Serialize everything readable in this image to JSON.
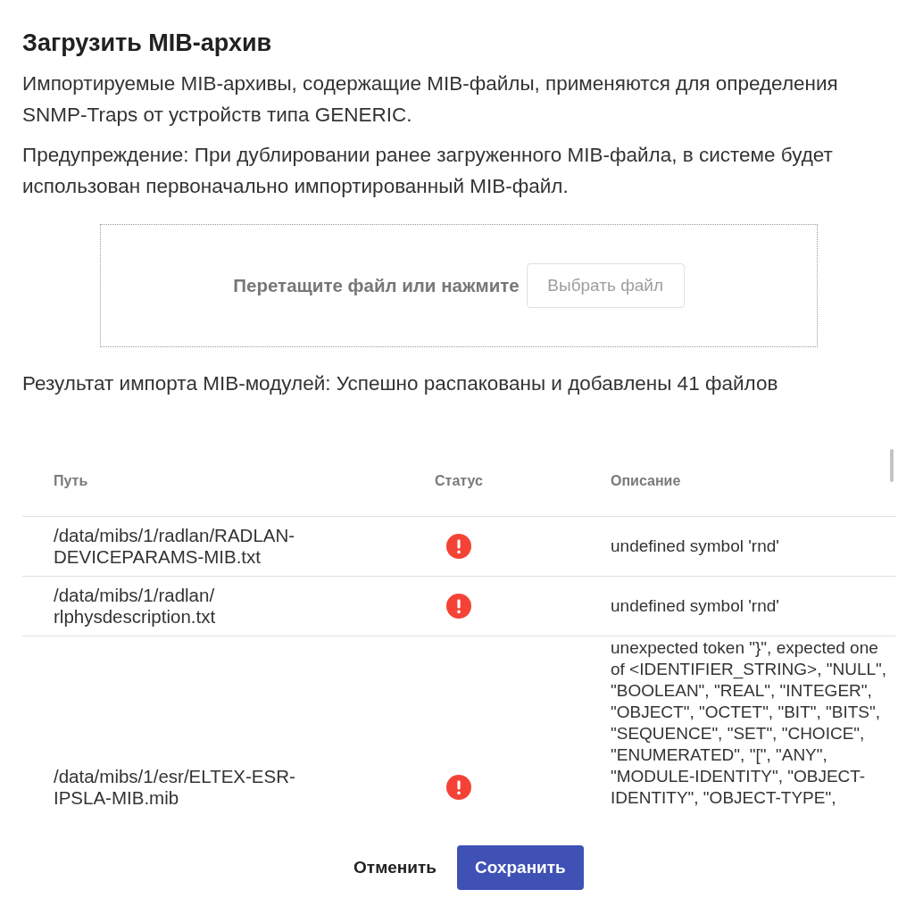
{
  "dialog": {
    "title": "Загрузить MIB-архив"
  },
  "paragraphs": [
    "Импортируемые MIB-архивы, содержащие MIB-файлы, применяются для определения SNMP-Traps от устройств типа GENERIC.",
    "Предупреждение: При дублировании ранее загруженного MIB-файла, в системе будет использован первоначально импортированный MIB-файл."
  ],
  "dropzone": {
    "prompt": "Перетащите файл или нажмите",
    "button": "Выбрать файл"
  },
  "result": "Результат импорта MIB-модулей: Успешно распакованы и добавлены 41 файлов",
  "table": {
    "columns": [
      "Путь",
      "Статус",
      "Описание"
    ],
    "rows": [
      {
        "path": "/data/mibs/1/radlan/RADLAN-DEVICEPARAMS-MIB.txt",
        "error": true,
        "description": "undefined symbol 'rnd'"
      },
      {
        "path": "/data/mibs/1/radlan/rlphysdescription.txt",
        "error": true,
        "description": "undefined symbol 'rnd'"
      },
      {
        "path": "/data/mibs/1/esr/ELTEX-ESR-IPSLA-MIB.mib",
        "error": true,
        "description": "unexpected token \"}\", expected one of <IDENTIFIER_STRING>, \"NULL\", \"BOOLEAN\", \"REAL\", \"INTEGER\", \"OBJECT\", \"OCTET\", \"BIT\", \"BITS\", \"SEQUENCE\", \"SET\", \"CHOICE\", \"ENUMERATED\", \"[\", \"ANY\", \"MODULE-IDENTITY\", \"OBJECT-IDENTITY\", \"OBJECT-TYPE\","
      }
    ]
  },
  "buttons": [
    {
      "label": "Отменить",
      "kind": "text"
    },
    {
      "label": "Сохранить",
      "kind": "primary"
    }
  ]
}
